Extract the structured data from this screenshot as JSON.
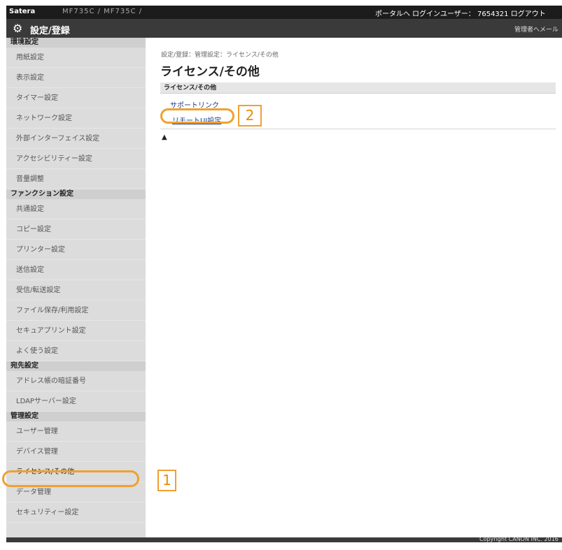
{
  "topbar": {
    "system_name": "Satera",
    "device_path": "MF735C / MF735C /",
    "portal": "ポータルへ",
    "login_user": "ログインユーザー： 7654321 ログアウト"
  },
  "header": {
    "icon": "gear-icon",
    "title": "設定/登録",
    "admin_mail": "管理者へメール"
  },
  "sidebar": {
    "sections": [
      {
        "title": "環境設定",
        "items": [
          "用紙設定",
          "表示設定",
          "タイマー設定",
          "ネットワーク設定",
          "外部インターフェイス設定",
          "アクセシビリティー設定",
          "音量調整"
        ]
      },
      {
        "title": "ファンクション設定",
        "items": [
          "共通設定",
          "コピー設定",
          "プリンター設定",
          "送信設定",
          "受信/転送設定",
          "ファイル保存/利用設定",
          "セキュアプリント設定",
          "よく使う設定"
        ]
      },
      {
        "title": "宛先設定",
        "items": [
          "アドレス帳の暗証番号",
          "LDAPサーバー設定"
        ]
      },
      {
        "title": "管理設定",
        "items": [
          "ユーザー管理",
          "デバイス管理",
          "ライセンス/その他",
          "データ管理",
          "セキュリティー設定"
        ]
      }
    ]
  },
  "main": {
    "breadcrumb": "設定/登録：管理設定：ライセンス/その他",
    "page_title": "ライセンス/その他",
    "section_title": "ライセンス/その他",
    "links": [
      "サポートリンク",
      "リモートUI設定"
    ],
    "top_icon": "▲"
  },
  "callouts": [
    "1",
    "2"
  ],
  "footer": {
    "copyright": "Copyright CANON INC. 2016"
  },
  "colors": {
    "accent": "#f0a030",
    "header": "#3a3a3a",
    "topbar": "#1c1c1c",
    "sidebar": "#dcdcdc"
  }
}
